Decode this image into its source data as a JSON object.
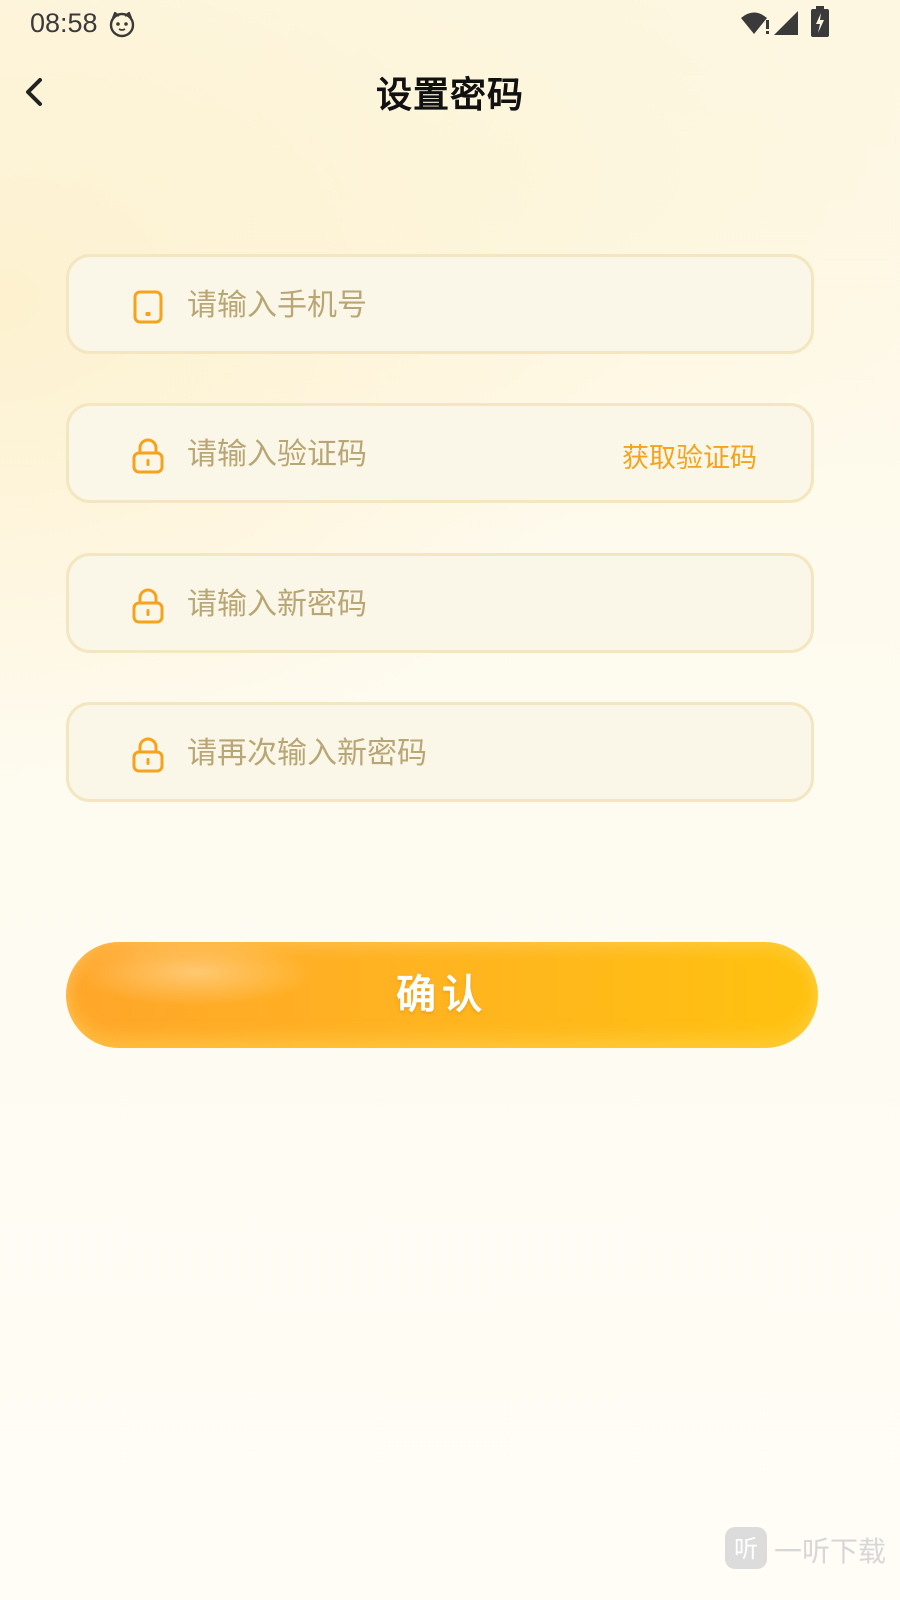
{
  "status_bar": {
    "time": "08:58",
    "app_icon": "cat-face-icon",
    "wifi_icon": "wifi-alert-icon",
    "signal_icon": "cell-signal-icon",
    "battery_icon": "battery-charging-icon"
  },
  "header": {
    "back_icon": "chevron-left-icon",
    "title": "设置密码"
  },
  "form": {
    "phone": {
      "icon": "phone-icon",
      "placeholder": "请输入手机号",
      "value": ""
    },
    "code": {
      "icon": "lock-icon",
      "placeholder": "请输入验证码",
      "value": "",
      "get_code_label": "获取验证码"
    },
    "new_password": {
      "icon": "lock-icon",
      "placeholder": "请输入新密码",
      "value": ""
    },
    "confirm_password": {
      "icon": "lock-icon",
      "placeholder": "请再次输入新密码",
      "value": ""
    },
    "confirm_label": "确认"
  },
  "watermark": {
    "icon_glyph": "听",
    "text": "一听下载"
  },
  "colors": {
    "accent": "#f5a31c",
    "placeholder": "#b8a675",
    "field_border": "#f3e6c0",
    "field_bg": "#fbf7e8",
    "button_start": "#ffa62a",
    "button_end": "#ffc20f"
  }
}
